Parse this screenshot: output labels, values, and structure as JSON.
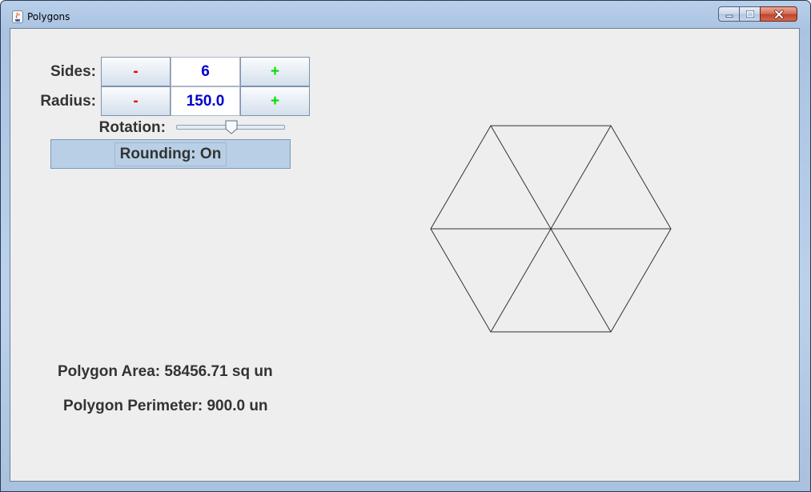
{
  "window": {
    "title": "Polygons",
    "icon": "java-cup-icon"
  },
  "controls": {
    "sides": {
      "label": "Sides:",
      "value": "6",
      "decrement_label": "-",
      "increment_label": "+"
    },
    "radius": {
      "label": "Radius:",
      "value": "150.0",
      "decrement_label": "-",
      "increment_label": "+"
    },
    "rotation": {
      "label": "Rotation:",
      "value_fraction": 0.5
    },
    "rounding": {
      "label": "Rounding: On"
    }
  },
  "stats": {
    "area": "Polygon Area: 58456.71 sq un",
    "perimeter": "Polygon Perimeter: 900.0 un"
  },
  "polygon": {
    "sides": 6,
    "radius": 150.0,
    "rotation_deg": 0,
    "show_spokes": true,
    "stroke_color": "#333333"
  },
  "colors": {
    "minus": "#ee0000",
    "plus": "#00dd00",
    "value_text": "#0000cc",
    "toggle_bg": "#b8cfe6"
  }
}
